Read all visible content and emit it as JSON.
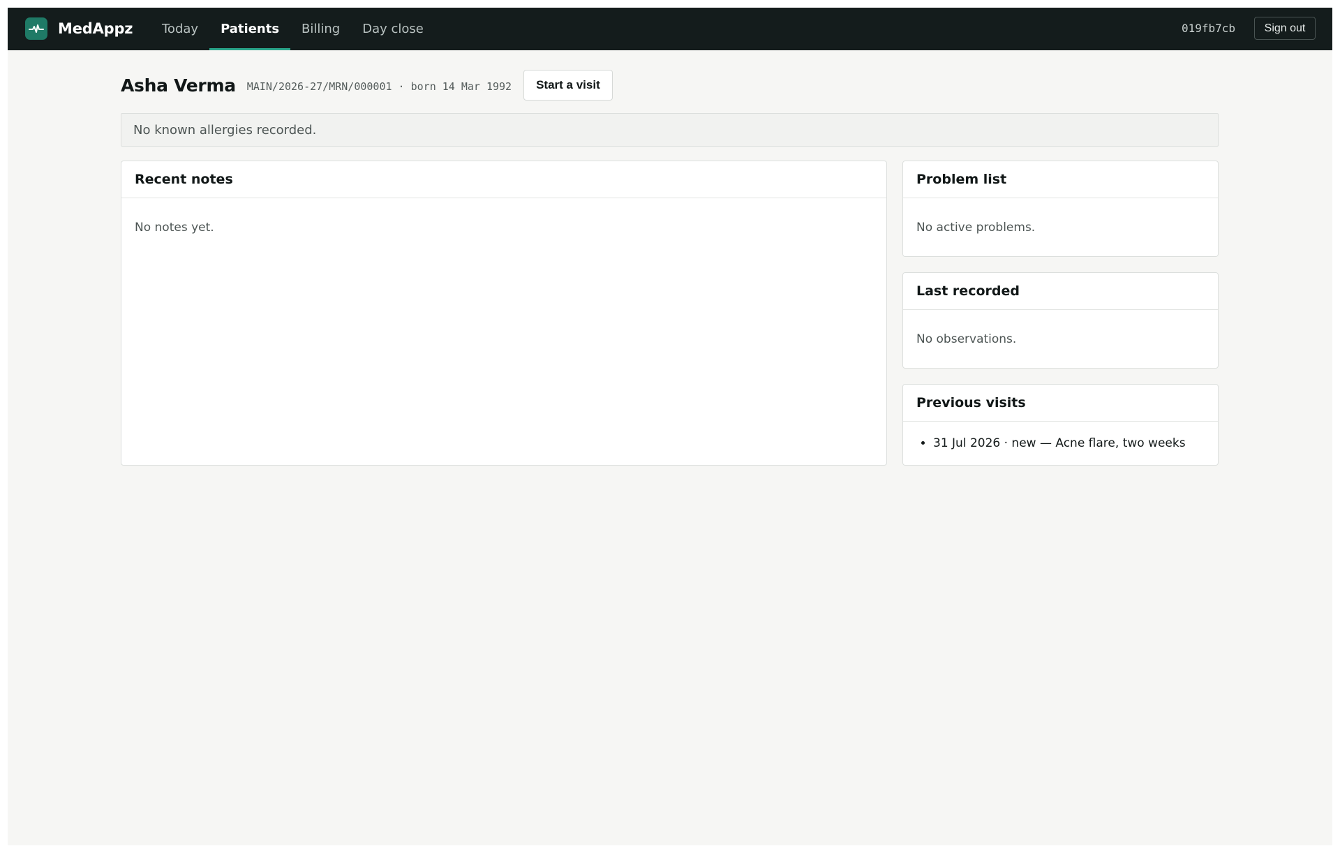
{
  "app": {
    "name": "MedAppz",
    "logo_icon": "pulse-icon",
    "accent": "#1f7a66"
  },
  "nav": {
    "items": [
      {
        "label": "Today",
        "active": false
      },
      {
        "label": "Patients",
        "active": true
      },
      {
        "label": "Billing",
        "active": false
      },
      {
        "label": "Day close",
        "active": false
      }
    ]
  },
  "user": {
    "code": "019fb7cb",
    "signout_label": "Sign out"
  },
  "patient": {
    "name": "Asha Verma",
    "meta": "MAIN/2026-27/MRN/000001 · born 14 Mar 1992",
    "start_visit_label": "Start a visit"
  },
  "allergies": {
    "text": "No known allergies recorded."
  },
  "recent_notes": {
    "title": "Recent notes",
    "empty": "No notes yet."
  },
  "problem_list": {
    "title": "Problem list",
    "empty": "No active problems."
  },
  "last_recorded": {
    "title": "Last recorded",
    "empty": "No observations."
  },
  "previous_visits": {
    "title": "Previous visits",
    "items": [
      "31 Jul 2026 · new — Acne flare, two weeks"
    ]
  }
}
